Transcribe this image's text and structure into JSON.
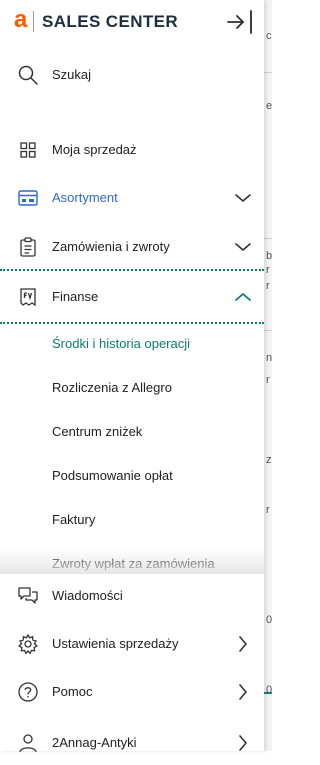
{
  "app": {
    "logo_letter": "a",
    "title": "SALES CENTER",
    "brand_color": "#ff5a00"
  },
  "nav": {
    "search": "Szukaj",
    "my_sales": "Moja sprzedaż",
    "assortment": "Asortyment",
    "orders": "Zamówienia i zwroty",
    "finance": "Finanse"
  },
  "finance_sub": {
    "items": [
      "Środki i historia operacji",
      "Rozliczenia z Allegro",
      "Centrum zniżek",
      "Podsumowanie opłat",
      "Faktury",
      "Zwroty wpłat za zamówienia"
    ]
  },
  "bottom_nav": {
    "messages": "Wiadomości",
    "settings": "Ustawienia sprzedaży",
    "help": "Pomoc",
    "account": "2Annag-Antyki"
  },
  "background_fragments": [
    "c",
    "e",
    "b",
    "r",
    "r",
    "n",
    "r",
    "z",
    "r",
    "0",
    "0"
  ],
  "colors": {
    "active_blue": "#2f6ac9",
    "finance_teal": "#0b7c70"
  }
}
